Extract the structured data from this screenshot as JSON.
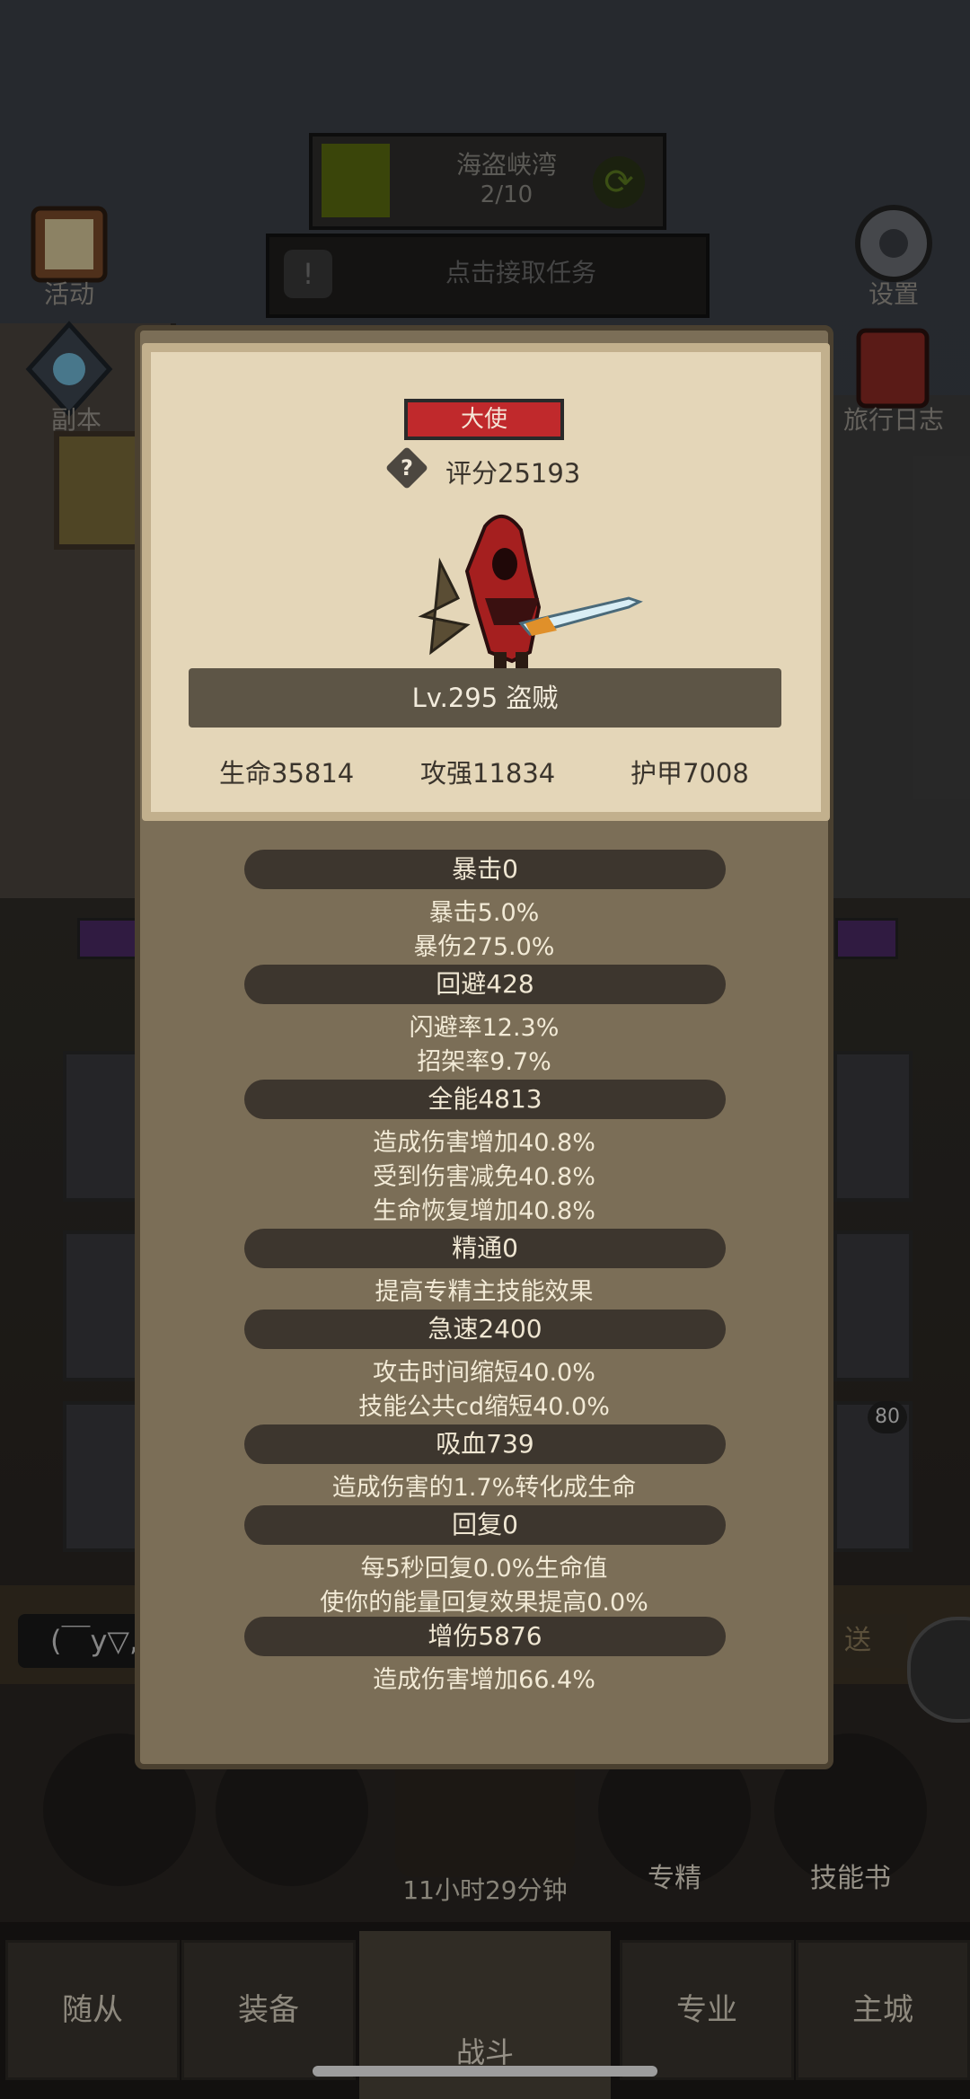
{
  "top_hud": {
    "map_name": "海盗峡湾",
    "map_progress": "2/10",
    "quest_text": "点击接取任务",
    "left_icons": [
      {
        "label": "活动",
        "icon": "scroll-icon"
      },
      {
        "label": "副本",
        "icon": "portal-icon"
      }
    ],
    "right_icons": [
      {
        "label": "设置",
        "icon": "gear-icon"
      },
      {
        "label": "旅行日志",
        "icon": "journal-icon"
      }
    ]
  },
  "hero_card": {
    "rank": "大使",
    "score": "评分25193",
    "name_level": "Lv.295 盗贼",
    "stats": {
      "hp": "生命35814",
      "attack": "攻强11834",
      "armor": "护甲7008"
    }
  },
  "stat_groups": [
    {
      "header": "暴击0",
      "details": [
        "暴击5.0%",
        "暴伤275.0%"
      ]
    },
    {
      "header": "回避428",
      "details": [
        "闪避率12.3%",
        "招架率9.7%"
      ]
    },
    {
      "header": "全能4813",
      "details": [
        "造成伤害增加40.8%",
        "受到伤害减免40.8%",
        "生命恢复增加40.8%"
      ]
    },
    {
      "header": "精通0",
      "details": [
        "提高专精主技能效果"
      ]
    },
    {
      "header": "急速2400",
      "details": [
        "攻击时间缩短40.0%",
        "技能公共cd缩短40.0%"
      ]
    },
    {
      "header": "吸血739",
      "details": [
        "造成伤害的1.7%转化成生命"
      ]
    },
    {
      "header": "回复0",
      "details": [
        "每5秒回复0.0%生命值",
        "使你的能量回复效果提高0.0%"
      ]
    },
    {
      "header": "增伤5876",
      "details": [
        "造成伤害增加66.4%"
      ]
    }
  ],
  "background": {
    "slot_badge": "80",
    "chat_input": "(￣y▽,",
    "send_label": "送",
    "round_buttons": [
      {
        "label": "",
        "icon": "potion-icon"
      },
      {
        "label": "",
        "icon": "bread-icon"
      },
      {
        "label": "",
        "icon": "chest-icon"
      },
      {
        "label": "专精",
        "icon": "specialty-icon"
      },
      {
        "label": "技能书",
        "icon": "skillbook-icon"
      }
    ],
    "timer": "11小时29分钟"
  },
  "bottom_nav": {
    "tabs": [
      "随从",
      "装备",
      "专业",
      "主城"
    ],
    "center_label": "战斗"
  },
  "colors": {
    "panel": "#7b6e57",
    "card": "#e4d6b8",
    "rank_red": "#c0292c",
    "group_bar": "#3d362e"
  }
}
